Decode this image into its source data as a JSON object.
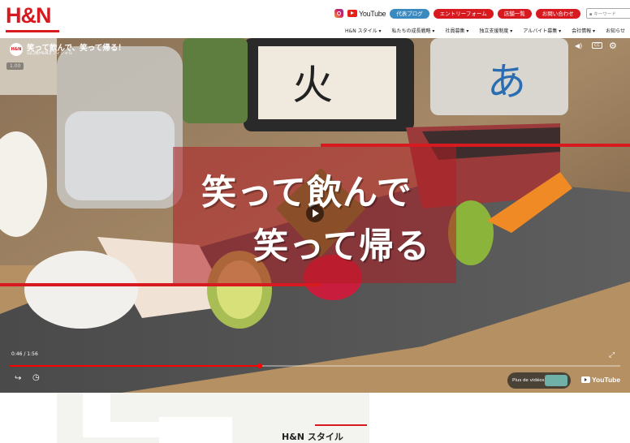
{
  "header": {
    "logo": "H&N",
    "youtube_label": "YouTube",
    "buttons": [
      "代表ブログ",
      "エントリーフォーム",
      "店舗一覧",
      "お問い合わせ"
    ],
    "search_placeholder": "キーワード",
    "nav": [
      "H&N スタイル ▾",
      "私たちの成長戦略 ▾",
      "社員募集 ▾",
      "独立支援制度 ▾",
      "アルバイト募集 ▾",
      "会社情報 ▾",
      "お知らせ"
    ]
  },
  "video": {
    "title": "笑って飲んで、笑って帰る！",
    "channel": "山口県H&Nオフィシャル",
    "channel_logo": "H&N",
    "badge": "1.00",
    "overlay_line1": "笑って飲んで",
    "overlay_line2": "笑って帰る",
    "time": "0:46 / 1:56",
    "progress": 0.41,
    "more_videos": "Plus de vidéos",
    "youtube_brand": "YouTube",
    "icons": [
      "volume-icon",
      "captions-icon",
      "settings-icon",
      "share-icon",
      "watch-later-icon",
      "fullscreen-icon",
      "play-icon"
    ]
  },
  "section": {
    "title": "H&N スタイル"
  },
  "colors": {
    "brand_red": "#d71920",
    "blue": "#3a8ac0"
  }
}
